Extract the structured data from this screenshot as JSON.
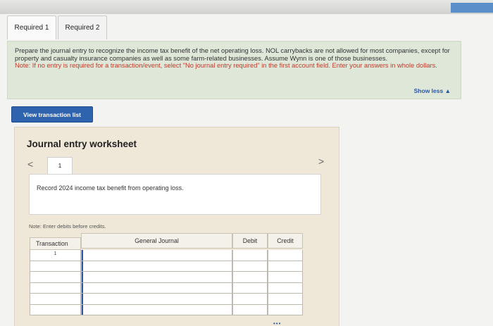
{
  "tabs": [
    {
      "label": "Required 1"
    },
    {
      "label": "Required 2"
    }
  ],
  "prompt": {
    "text": "Prepare the journal entry to recognize the income tax benefit of the net operating loss. NOL carrybacks are not allowed for most companies, except for property and casualty insurance companies as well as some farm-related businesses. Assume Wynn is one of those businesses.",
    "note": "Note: If no entry is required for a transaction/event, select \"No journal entry required\" in the first account field. Enter your answers in whole dollars.",
    "show_less": "Show less ▲"
  },
  "view_button": "View transaction list",
  "worksheet": {
    "title": "Journal entry worksheet",
    "prev_icon": "<",
    "next_icon": ">",
    "step": "1",
    "instruction": "Record 2024 income tax benefit from operating loss.",
    "note": "Note: Enter debits before credits."
  },
  "table": {
    "headers": {
      "transaction": "Transaction",
      "general_journal": "General Journal",
      "debit": "Debit",
      "credit": "Credit"
    },
    "rows": [
      {
        "transaction": "1"
      },
      {
        "transaction": ""
      },
      {
        "transaction": ""
      },
      {
        "transaction": ""
      },
      {
        "transaction": ""
      },
      {
        "transaction": ""
      }
    ]
  },
  "colors": {
    "accent_blue": "#2f63ad",
    "prompt_bg": "#dfe8d8",
    "worksheet_bg": "#efe7d7",
    "note_red": "#c0392b"
  },
  "footer_dots": "•••"
}
